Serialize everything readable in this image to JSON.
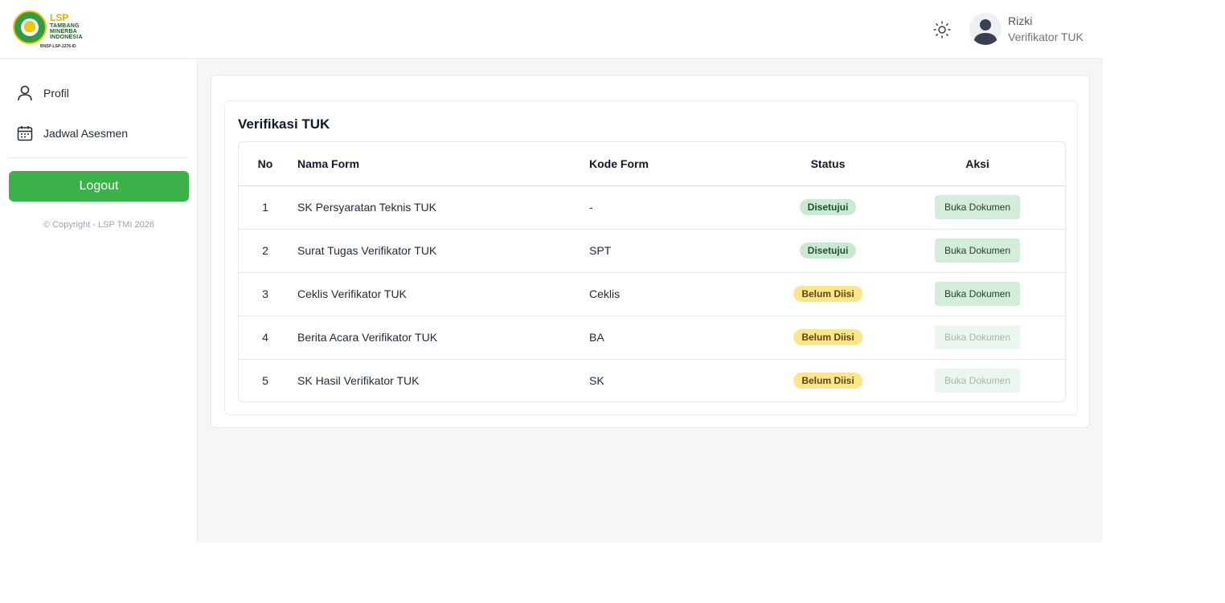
{
  "logo": {
    "lsp": "LSP",
    "line1": "TAMBANG",
    "line2": "MINERBA",
    "line3": "INDONESIA",
    "sub": "BNSP-LSP-2276-ID"
  },
  "header": {
    "theme_icon": "sun-icon",
    "user_name": "Rizki",
    "user_role": "Verifikator TUK"
  },
  "sidebar": {
    "items": [
      {
        "label": "Profil",
        "icon": "user-icon"
      },
      {
        "label": "Jadwal Asesmen",
        "icon": "calendar-icon"
      }
    ],
    "logout_label": "Logout",
    "copyright": "© Copyright - LSP TMI 2026"
  },
  "main": {
    "title": "Verifikasi TUK",
    "columns": [
      "No",
      "Nama Form",
      "Kode Form",
      "Status",
      "Aksi"
    ],
    "rows": [
      {
        "no": "1",
        "nama": "SK Persyaratan Teknis TUK",
        "kode": "-",
        "status": "Disetujui",
        "status_color": "#c9ead0",
        "aksi": "Buka Dokumen",
        "enabled": true
      },
      {
        "no": "2",
        "nama": "Surat Tugas Verifikator TUK",
        "kode": "SPT",
        "status": "Disetujui",
        "status_color": "#c9ead0",
        "aksi": "Buka Dokumen",
        "enabled": true
      },
      {
        "no": "3",
        "nama": "Ceklis Verifikator TUK",
        "kode": "Ceklis",
        "status": "Belum Diisi",
        "status_color": "#fde68a",
        "aksi": "Buka Dokumen",
        "enabled": true
      },
      {
        "no": "4",
        "nama": "Berita Acara Verifikator TUK",
        "kode": "BA",
        "status": "Belum Diisi",
        "status_color": "#fde68a",
        "aksi": "Buka Dokumen",
        "enabled": false
      },
      {
        "no": "5",
        "nama": "SK Hasil Verifikator TUK",
        "kode": "SK",
        "status": "Belum Diisi",
        "status_color": "#fde68a",
        "aksi": "Buka Dokumen",
        "enabled": false
      }
    ]
  },
  "colors": {
    "primary": "#3bb14a",
    "approved": "#c9ead0",
    "pending": "#fde68a"
  }
}
